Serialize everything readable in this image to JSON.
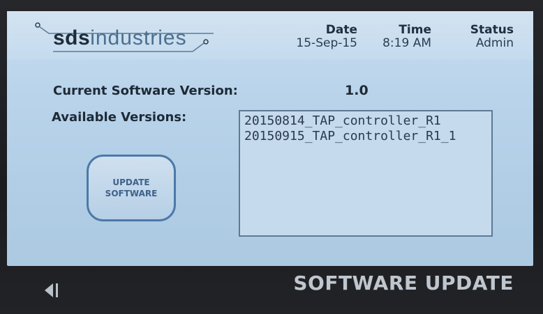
{
  "header": {
    "logo_text_bold": "sds",
    "logo_text_light": "industries",
    "date_label": "Date",
    "date_value": "15-Sep-15",
    "time_label": "Time",
    "time_value": "8:19 AM",
    "status_label": "Status",
    "status_value": "Admin"
  },
  "main": {
    "current_version_label": "Current Software Version:",
    "current_version_value": "1.0",
    "available_versions_label": "Available Versions:",
    "update_button_label": "UPDATE\nSOFTWARE",
    "versions": [
      "20150814_TAP_controller_R1",
      "20150915_TAP_controller_R1_1"
    ]
  },
  "footer": {
    "back_icon": "back-arrow-icon",
    "title": "SOFTWARE UPDATE"
  },
  "colors": {
    "screen_bg": "#b8d3ea",
    "button_border": "#4c79a8",
    "text_dark": "#1e2a36",
    "footer_text": "#bfc6ce"
  }
}
